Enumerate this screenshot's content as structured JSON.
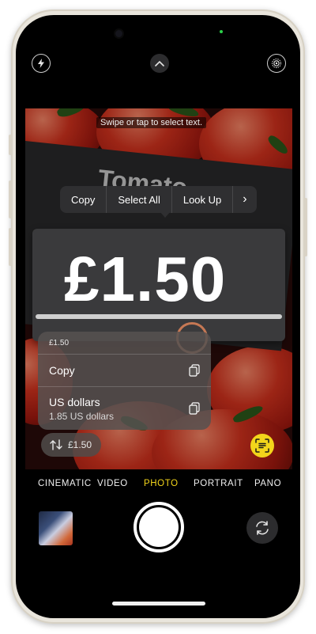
{
  "viewfinder": {
    "hint": "Swipe or tap to select text.",
    "sign_label": "Tomato",
    "price": "£1.50"
  },
  "edit_menu": {
    "copy": "Copy",
    "select_all": "Select All",
    "look_up": "Look Up",
    "more": "›"
  },
  "popover": {
    "header": "£1.50",
    "rows": [
      {
        "title": "Copy",
        "subtitle": ""
      },
      {
        "title": "US dollars",
        "subtitle": "1.85 US dollars"
      }
    ]
  },
  "convert_chip": {
    "label": "£1.50"
  },
  "modes": {
    "items": [
      "CINEMATIC",
      "VIDEO",
      "PHOTO",
      "PORTRAIT",
      "PANO"
    ],
    "selected": "PHOTO",
    "selected_color": "#f3d51b"
  },
  "colors": {
    "accent": "#f3d51b",
    "frame": "#e9e5dc"
  }
}
